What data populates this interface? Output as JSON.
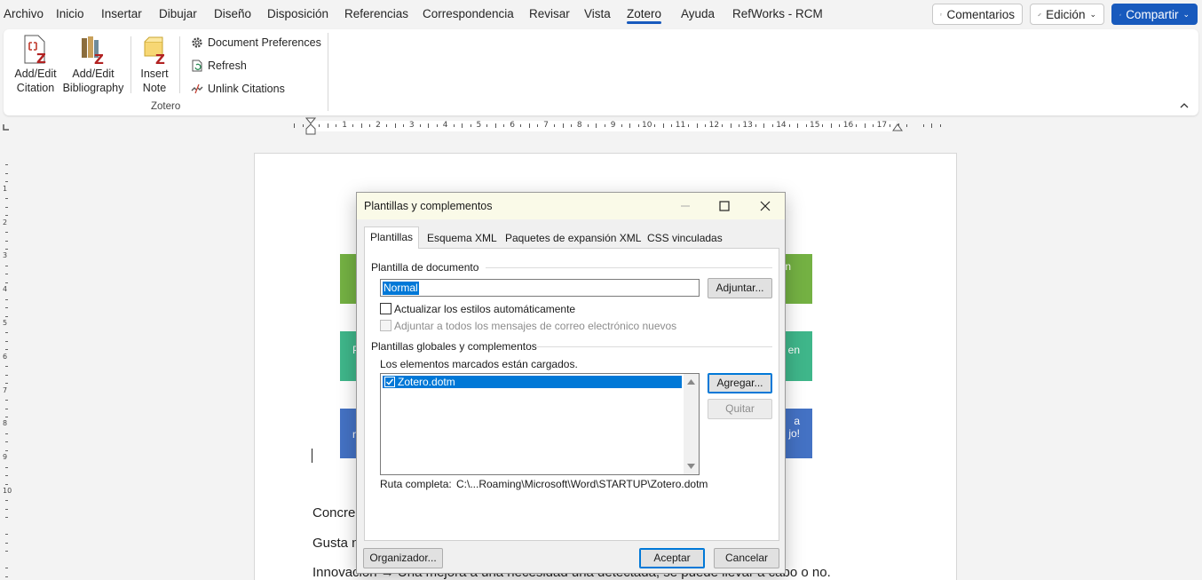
{
  "menu": {
    "items": [
      "Archivo",
      "Inicio",
      "Insertar",
      "Dibujar",
      "Diseño",
      "Disposición",
      "Referencias",
      "Correspondencia",
      "Revisar",
      "Vista",
      "Zotero",
      "Ayuda",
      "RefWorks - RCM"
    ],
    "active": "Zotero",
    "comments_label": "Comentarios",
    "editing_label": "Edición",
    "share_label": "Compartir"
  },
  "ribbon": {
    "add_citation_line1": "Add/Edit",
    "add_citation_line2": "Citation",
    "add_bibliography_line1": "Add/Edit",
    "add_bibliography_line2": "Bibliography",
    "insert_note_line1": "Insert",
    "insert_note_line2": "Note",
    "doc_prefs": "Document Preferences",
    "refresh": "Refresh",
    "unlink": "Unlink Citations",
    "group_label": "Zotero"
  },
  "ruler": {
    "numbers": [
      "1",
      "2",
      "3",
      "4",
      "5",
      "6",
      "7",
      "8",
      "9",
      "10",
      "11",
      "12",
      "13",
      "14",
      "15",
      "16",
      "17"
    ],
    "vertical_numbers": [
      "1",
      "2",
      "3",
      "4",
      "5",
      "6",
      "7",
      "8",
      "9",
      "10"
    ]
  },
  "document": {
    "band_fragments": [
      "n",
      "P",
      "en",
      "n",
      "a",
      "jo!"
    ],
    "line1": "Concre",
    "line2": "Gusta n",
    "line3": "Innovación → Una mejora a una necesidad una detectada, se puede llevar a cabo o no."
  },
  "dialog": {
    "title": "Plantillas y complementos",
    "tabs": [
      "Plantillas",
      "Esquema XML",
      "Paquetes de expansión XML",
      "CSS vinculadas"
    ],
    "selected_tab": "Plantillas",
    "doc_template_label": "Plantilla de documento",
    "doc_template_value": "Normal",
    "attach_button": "Adjuntar...",
    "auto_update_label": "Actualizar los estilos automáticamente",
    "auto_update_checked": false,
    "attach_all_label": "Adjuntar a todos los mensajes de correo electrónico nuevos",
    "attach_all_checked": false,
    "global_label": "Plantillas globales y complementos",
    "loaded_note": "Los elementos marcados están cargados.",
    "addins": [
      {
        "name": "Zotero.dotm",
        "checked": true
      }
    ],
    "add_button": "Agregar...",
    "remove_button": "Quitar",
    "path_label": "Ruta completa:",
    "path_value": "C:\\...Roaming\\Microsoft\\Word\\STARTUP\\Zotero.dotm",
    "organizer_button": "Organizador...",
    "ok_button": "Aceptar",
    "cancel_button": "Cancelar"
  }
}
